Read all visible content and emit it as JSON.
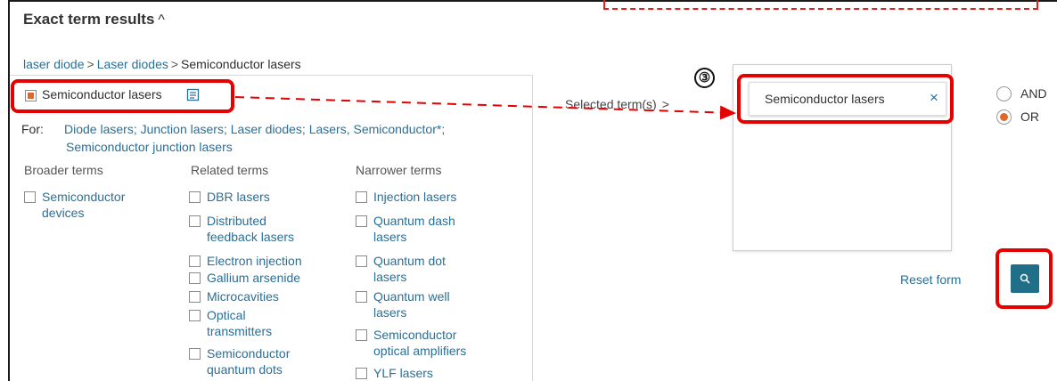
{
  "header": {
    "title": "Exact term results",
    "caret": "^"
  },
  "breadcrumb": {
    "item1": "laser diode",
    "item2": "Laser diodes",
    "current": "Semiconductor lasers",
    "sep": ">"
  },
  "main_term": {
    "label": "Semiconductor lasers"
  },
  "for_line": {
    "label": "For:",
    "line1_links": "Diode lasers; Junction lasers; Laser diodes; Lasers, Semiconductor*;",
    "line2_links": "Semiconductor junction lasers"
  },
  "columns": {
    "broader": "Broader terms",
    "related": "Related terms",
    "narrower": "Narrower terms"
  },
  "broader_terms": [
    [
      "Semiconductor",
      "devices"
    ]
  ],
  "related_terms": [
    [
      "DBR lasers"
    ],
    [
      "Distributed",
      "feedback lasers"
    ],
    [
      "Electron injection"
    ],
    [
      "Gallium arsenide"
    ],
    [
      "Microcavities"
    ],
    [
      "Optical",
      "transmitters"
    ],
    [
      "Semiconductor",
      "quantum dots"
    ]
  ],
  "narrower_terms": [
    [
      "Injection lasers"
    ],
    [
      "Quantum dash",
      "lasers"
    ],
    [
      "Quantum dot",
      "lasers"
    ],
    [
      "Quantum well",
      "lasers"
    ],
    [
      "Semiconductor",
      "optical amplifiers"
    ],
    [
      "YLF lasers"
    ]
  ],
  "selected": {
    "label": "Selected term(s)",
    "chevron": ">",
    "chip_label": "Semiconductor lasers",
    "chip_remove": "×"
  },
  "annotation": {
    "step": "③"
  },
  "operators": {
    "and_label": "AND",
    "or_label": "OR",
    "selected": "OR"
  },
  "actions": {
    "reset_label": "Reset form"
  },
  "colors": {
    "link": "#2a6f97",
    "accent": "#e0672c",
    "highlight": "#e60000",
    "button": "#1f6f88"
  }
}
